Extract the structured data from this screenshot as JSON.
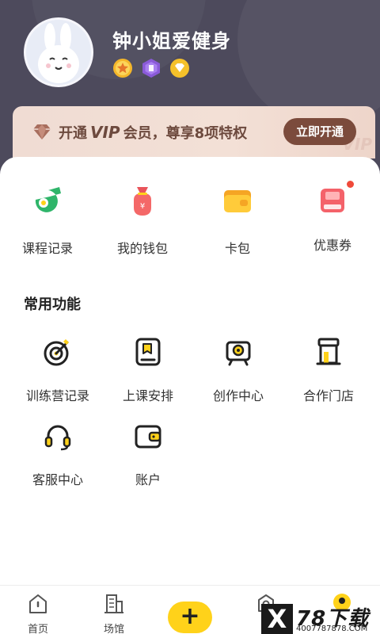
{
  "profile": {
    "username": "钟小姐爱健身",
    "badges": [
      "star-medal-icon",
      "purple-hex-badge-icon",
      "gold-diamond-badge-icon"
    ]
  },
  "vip": {
    "prefix": "开通",
    "brand": "VIP",
    "suffix": "会员，尊享8项特权",
    "button": "立即开通",
    "watermark": "VIP"
  },
  "quick": [
    {
      "label": "课程记录",
      "icon": "whistle-icon"
    },
    {
      "label": "我的钱包",
      "icon": "money-bag-icon"
    },
    {
      "label": "卡包",
      "icon": "card-wallet-icon"
    },
    {
      "label": "优惠券",
      "icon": "coupon-icon"
    }
  ],
  "common": {
    "title": "常用功能",
    "items": [
      {
        "label": "训练营记录",
        "icon": "target-icon"
      },
      {
        "label": "上课安排",
        "icon": "schedule-icon"
      },
      {
        "label": "创作中心",
        "icon": "camera-icon"
      },
      {
        "label": "合作门店",
        "icon": "store-icon"
      },
      {
        "label": "客服中心",
        "icon": "headset-icon"
      },
      {
        "label": "账户",
        "icon": "wallet-icon"
      }
    ]
  },
  "tabbar": {
    "items": [
      {
        "label": "首页",
        "icon": "home-icon"
      },
      {
        "label": "场馆",
        "icon": "building-icon"
      },
      {
        "label": "+",
        "icon": "plus-icon"
      },
      {
        "label": "",
        "icon": "location-icon"
      },
      {
        "label": "",
        "icon": "profile-icon"
      }
    ]
  },
  "watermark": {
    "mark": "X",
    "title": "78下载",
    "url": "4007787878.COM"
  },
  "colors": {
    "header": "#4d4a5c",
    "accent": "#ffd21a",
    "vip_button": "#7b4b3c",
    "green": "#2fb56a",
    "red": "#f04a3a"
  }
}
